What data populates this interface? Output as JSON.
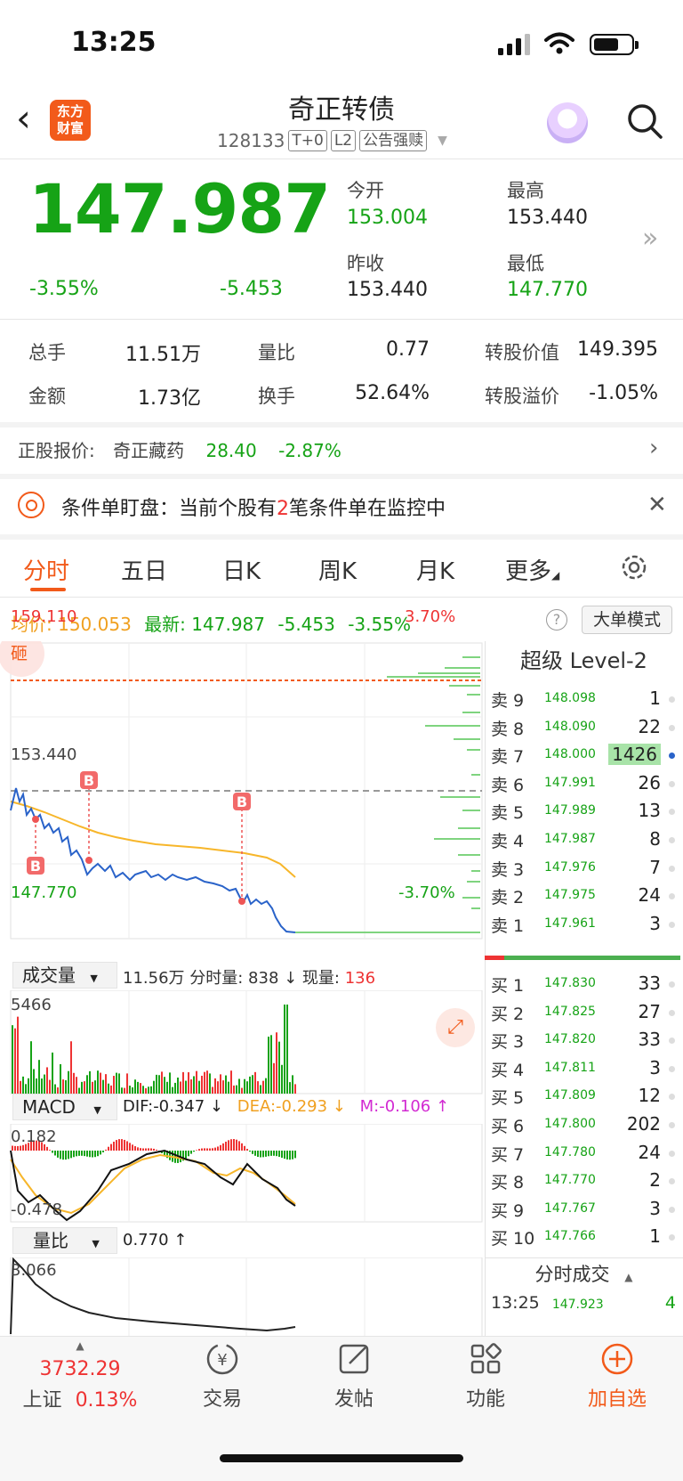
{
  "status": {
    "time": "13:25"
  },
  "header": {
    "logo_text_1": "东方",
    "logo_text_2": "财富",
    "title": "奇正转债",
    "code": "128133",
    "tags": [
      "T+0",
      "L2",
      "公告强赎"
    ]
  },
  "quote": {
    "price": "147.987",
    "change_pct": "-3.55%",
    "change": "-5.453",
    "open_label": "今开",
    "open": "153.004",
    "high_label": "最高",
    "high": "153.440",
    "prev_close_label": "昨收",
    "prev_close": "153.440",
    "low_label": "最低",
    "low": "147.770"
  },
  "stats": {
    "volume_label": "总手",
    "volume": "11.51万",
    "ratio_label": "量比",
    "ratio": "0.77",
    "conv_value_label": "转股价值",
    "conv_value": "149.395",
    "amount_label": "金额",
    "amount": "1.73亿",
    "turnover_label": "换手",
    "turnover": "52.64%",
    "premium_label": "转股溢价",
    "premium": "-1.05%"
  },
  "stock_link": {
    "label": "正股报价:",
    "name": "奇正藏药",
    "price": "28.40",
    "pct": "-2.87%"
  },
  "condition": {
    "text_a": "条件单盯盘：当前个股有",
    "count": "2",
    "text_b": "笔条件单在监控中"
  },
  "tabs": [
    "分时",
    "五日",
    "日K",
    "周K",
    "月K",
    "更多"
  ],
  "infobar": {
    "avg_label": "均价:",
    "avg": "150.053",
    "latest_label": "最新:",
    "latest": "147.987",
    "chg": "-5.453",
    "pct": "-3.55%",
    "big_order": "大单模式"
  },
  "chart": {
    "y_top": "159.110",
    "y_top_pct": "3.70%",
    "y_mid": "153.440",
    "y_bot": "147.770",
    "y_bot_pct": "-3.70%",
    "marker_top": "砸",
    "b_label": "B",
    "vol_label": "成交量",
    "vol_info_total": "11.56万",
    "vol_info_rest": "分时量: 838 ↓ 现量:",
    "vol_now": "136",
    "vol_max": "5466",
    "macd_label": "MACD",
    "dif": "DIF:-0.347 ↓",
    "dea": "DEA:-0.293 ↓",
    "m": "M:-0.106 ↑",
    "macd_top": "0.182",
    "macd_bot": "-0.478",
    "ratio_label": "量比",
    "ratio_val": "0.770 ↑",
    "ratio_top": "3.066"
  },
  "level2": {
    "title": "超级 Level-2",
    "asks": [
      {
        "l": "卖 9",
        "p": "148.098",
        "v": "1"
      },
      {
        "l": "卖 8",
        "p": "148.090",
        "v": "22"
      },
      {
        "l": "卖 7",
        "p": "148.000",
        "v": "1426"
      },
      {
        "l": "卖 6",
        "p": "147.991",
        "v": "26"
      },
      {
        "l": "卖 5",
        "p": "147.989",
        "v": "13"
      },
      {
        "l": "卖 4",
        "p": "147.987",
        "v": "8"
      },
      {
        "l": "卖 3",
        "p": "147.976",
        "v": "7"
      },
      {
        "l": "卖 2",
        "p": "147.975",
        "v": "24"
      },
      {
        "l": "卖 1",
        "p": "147.961",
        "v": "3"
      }
    ],
    "bids": [
      {
        "l": "买 1",
        "p": "147.830",
        "v": "33"
      },
      {
        "l": "买 2",
        "p": "147.825",
        "v": "27"
      },
      {
        "l": "买 3",
        "p": "147.820",
        "v": "33"
      },
      {
        "l": "买 4",
        "p": "147.811",
        "v": "3"
      },
      {
        "l": "买 5",
        "p": "147.809",
        "v": "12"
      },
      {
        "l": "买 6",
        "p": "147.800",
        "v": "202"
      },
      {
        "l": "买 7",
        "p": "147.780",
        "v": "24"
      },
      {
        "l": "买 8",
        "p": "147.770",
        "v": "2"
      },
      {
        "l": "买 9",
        "p": "147.767",
        "v": "3"
      },
      {
        "l": "买 10",
        "p": "147.766",
        "v": "1"
      }
    ],
    "ticks_title": "分时成交",
    "ticks": [
      {
        "t": "13:25",
        "p": "147.923",
        "v": "4"
      }
    ]
  },
  "bottom": {
    "index_value": "3732.29",
    "index_name": "上证",
    "index_pct": "0.13%",
    "trade": "交易",
    "post": "发帖",
    "func": "功能",
    "add": "加自选"
  }
}
